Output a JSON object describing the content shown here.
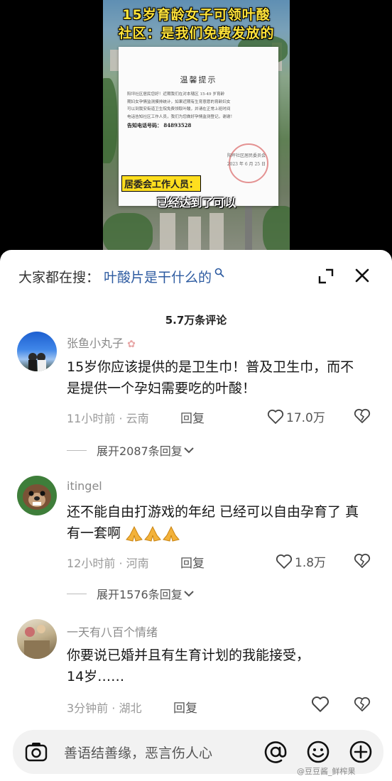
{
  "video": {
    "title_line1": "15岁育龄女子可领叶酸",
    "title_line2": "社区：是我们免费发放的",
    "notice": {
      "heading": "温馨提示",
      "body_lines": [
        "阳坪社区居民您好！近期我们在对本辖区 15-49 岁育龄",
        "期妇女孕情监测摸排统计，如果近期有生育意愿的育龄妇女",
        "可以到我安街道卫生院免费领取叶酸，并请在正常上班时间",
        "电话告知社区工作人员，我们为您做好孕情监测登记，谢谢！"
      ],
      "phone": "告知电话号码： 84893528",
      "signature": "阳坪社区居民委员会",
      "date": "2023 年 6 月 25 日"
    },
    "speaker_label": "居委会工作人员：",
    "subtitle": "已经达到了可以"
  },
  "sheet": {
    "search_label": "大家都在搜：",
    "search_term": "叶酸片是干什么的",
    "comment_count": "5.7万条评论"
  },
  "comments": [
    {
      "username": "张鱼小丸子",
      "text": "15岁你应该提供的是卫生巾！普及卫生巾，而不是提供一个孕妇需要吃的叶酸！",
      "time_location": "11小时前 · 云南",
      "reply_label": "回复",
      "likes": "17.0万",
      "expand_label": "展开2087条回复"
    },
    {
      "username": "itingel",
      "text": "还不能自由打游戏的年纪 已经可以自由孕育了 真有一套啊",
      "time_location": "12小时前 · 河南",
      "reply_label": "回复",
      "likes": "1.8万",
      "expand_label": "展开1576条回复"
    },
    {
      "username": "一天有八百个情绪",
      "text_line1": "你要说已婚并且有生育计划的我能接受，",
      "text_line2": "14岁……",
      "time_location": "3分钟前 · 湖北",
      "reply_label": "回复"
    }
  ],
  "input": {
    "placeholder": "善语结善缘，恶言伤人心"
  },
  "watermark": "@豆豆酱_鲜榨果",
  "colors": {
    "link_blue": "#2c5aa0",
    "title_yellow": "#ffe33a",
    "label_yellow": "#ffde1f",
    "text_dark": "#161616",
    "text_gray": "#9a9a9a"
  },
  "icons": [
    "search-icon",
    "expand-icon",
    "close-icon",
    "heart-icon",
    "dislike-icon",
    "chevron-down-icon",
    "camera-icon",
    "at-icon",
    "smile-icon",
    "plus-icon",
    "pray-emoji"
  ]
}
